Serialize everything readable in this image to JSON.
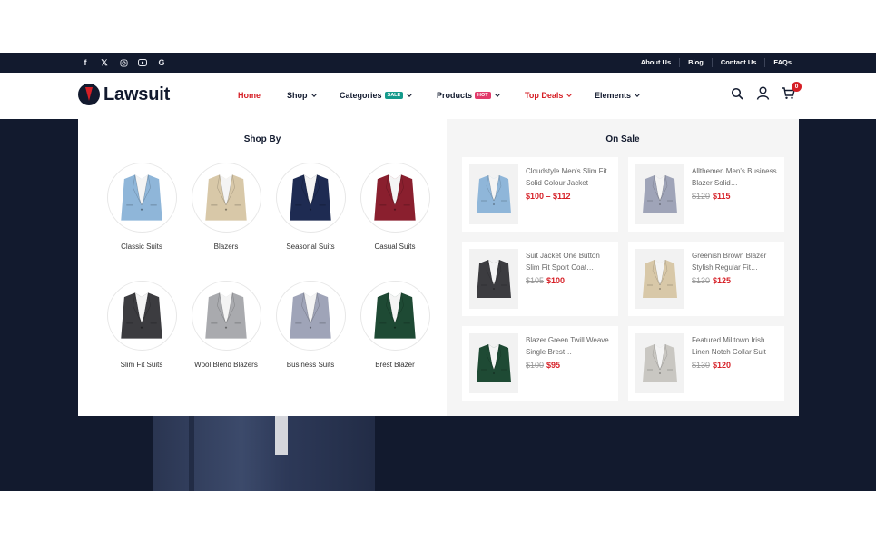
{
  "colors": {
    "brand_dark": "#121a2e",
    "accent_red": "#d61f26",
    "sale_badge": "#149a8b",
    "hot_badge": "#e23b6b"
  },
  "topbar": {
    "social_icons": [
      "facebook-icon",
      "x-icon",
      "instagram-icon",
      "youtube-icon",
      "google-icon"
    ],
    "links": [
      "About Us",
      "Blog",
      "Contact Us",
      "FAQs"
    ]
  },
  "header": {
    "logo_text": "Lawsuit",
    "nav": [
      {
        "label": "Home",
        "active": true
      },
      {
        "label": "Shop",
        "dropdown": true
      },
      {
        "label": "Categories",
        "badge": "SALE",
        "dropdown": true
      },
      {
        "label": "Products",
        "badge": "HOT",
        "dropdown": true
      },
      {
        "label": "Top Deals",
        "dropdown": true,
        "highlight": true
      },
      {
        "label": "Elements",
        "dropdown": true
      }
    ],
    "icons": [
      "search-icon",
      "user-icon",
      "cart-icon"
    ],
    "cart_count": "0"
  },
  "mega": {
    "shop_by": {
      "title": "Shop By",
      "categories": [
        {
          "label": "Classic Suits",
          "color": "#8fb6d9"
        },
        {
          "label": "Blazers",
          "color": "#d8c8a8"
        },
        {
          "label": "Seasonal Suits",
          "color": "#1e2b52"
        },
        {
          "label": "Casual Suits",
          "color": "#8a1f2e"
        },
        {
          "label": "Slim Fit Suits",
          "color": "#3c3c40"
        },
        {
          "label": "Wool Blend Blazers",
          "color": "#a9aaae"
        },
        {
          "label": "Business Suits",
          "color": "#9fa4b8"
        },
        {
          "label": "Brest Blazer",
          "color": "#1e4a34"
        }
      ]
    },
    "on_sale": {
      "title": "On Sale",
      "products": [
        {
          "name": "Cloudstyle Men's Slim Fit Solid Colour Jacket",
          "old_price": "",
          "price": "$100 – $112",
          "color": "#8fb6d9"
        },
        {
          "name": "Allthemen Men's Business Blazer Solid…",
          "old_price": "$120",
          "price": "$115",
          "color": "#9fa4b8"
        },
        {
          "name": "Suit Jacket One Button Slim Fit Sport Coat…",
          "old_price": "$105",
          "price": "$100",
          "color": "#3c3c40"
        },
        {
          "name": "Greenish Brown Blazer Stylish Regular Fit…",
          "old_price": "$130",
          "price": "$125",
          "color": "#d8c8a8"
        },
        {
          "name": "Blazer Green Twill Weave Single Brest…",
          "old_price": "$100",
          "price": "$95",
          "color": "#1e4a34"
        },
        {
          "name": "Featured Milltown Irish Linen Notch Collar Suit",
          "old_price": "$130",
          "price": "$120",
          "color": "#c9c7c2"
        }
      ]
    }
  }
}
